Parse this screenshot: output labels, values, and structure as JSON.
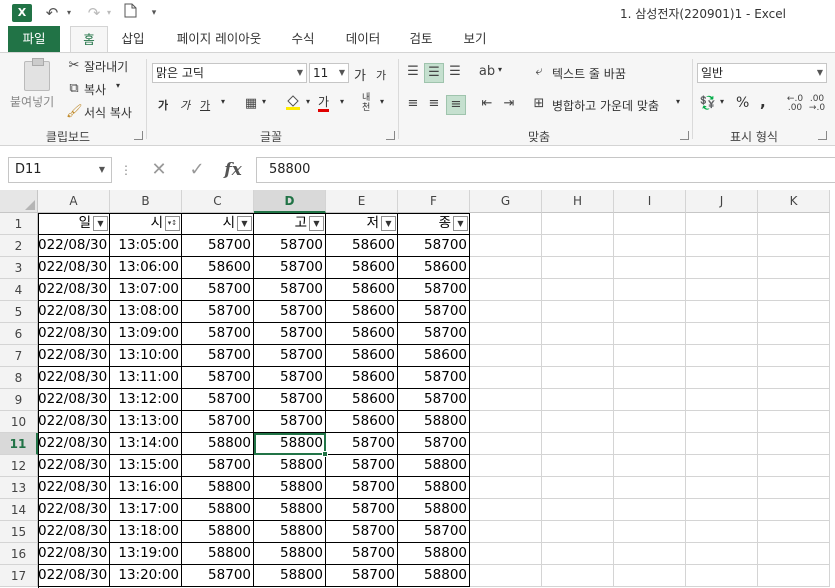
{
  "window": {
    "title": "1. 삼성전자(220901)1 - Excel"
  },
  "quick_access": {
    "save_icon": "save-icon",
    "undo_icon": "undo-icon",
    "redo_icon": "redo-icon",
    "new_icon": "new-file-icon",
    "customize_icon": "customize-icon"
  },
  "tabs": [
    {
      "label": "파일"
    },
    {
      "label": "홈"
    },
    {
      "label": "삽입"
    },
    {
      "label": "페이지 레이아웃"
    },
    {
      "label": "수식"
    },
    {
      "label": "데이터"
    },
    {
      "label": "검토"
    },
    {
      "label": "보기"
    }
  ],
  "ribbon": {
    "clipboard": {
      "paste_label": "붙여넣기",
      "cut_label": "잘라내기",
      "copy_label": "복사",
      "format_painter_label": "서식 복사",
      "group_label": "클립보드"
    },
    "font": {
      "font_name": "맑은 고딕",
      "font_size": "11",
      "grow_label": "가",
      "shrink_label": "가",
      "bold_label": "가",
      "italic_label": "가",
      "underline_label": "가",
      "color_label": "가",
      "phonetic_label": "내천",
      "group_label": "글꼴"
    },
    "alignment": {
      "wrap_label": "텍스트 줄 바꿈",
      "merge_label": "병합하고 가운데 맞춤",
      "group_label": "맞춤"
    },
    "number": {
      "format": "일반",
      "percent_label": "%",
      "comma_label": ",",
      "group_label": "표시 형식"
    }
  },
  "formula_bar": {
    "name_box": "D11",
    "fx_label": "fx",
    "content": "58800"
  },
  "sheet": {
    "columns": [
      "A",
      "B",
      "C",
      "D",
      "E",
      "F",
      "G",
      "H",
      "I",
      "J",
      "K"
    ],
    "selected_column": "D",
    "selected_row": 11,
    "headers": [
      "일",
      "시",
      "시",
      "고",
      "저",
      "종"
    ],
    "rows": [
      [
        "022/08/30",
        "13:05:00",
        "58700",
        "58700",
        "58600",
        "58700"
      ],
      [
        "022/08/30",
        "13:06:00",
        "58600",
        "58700",
        "58600",
        "58600"
      ],
      [
        "022/08/30",
        "13:07:00",
        "58700",
        "58700",
        "58600",
        "58700"
      ],
      [
        "022/08/30",
        "13:08:00",
        "58700",
        "58700",
        "58600",
        "58700"
      ],
      [
        "022/08/30",
        "13:09:00",
        "58700",
        "58700",
        "58600",
        "58700"
      ],
      [
        "022/08/30",
        "13:10:00",
        "58700",
        "58700",
        "58600",
        "58600"
      ],
      [
        "022/08/30",
        "13:11:00",
        "58700",
        "58700",
        "58600",
        "58700"
      ],
      [
        "022/08/30",
        "13:12:00",
        "58700",
        "58700",
        "58600",
        "58700"
      ],
      [
        "022/08/30",
        "13:13:00",
        "58700",
        "58700",
        "58600",
        "58800"
      ],
      [
        "022/08/30",
        "13:14:00",
        "58800",
        "58800",
        "58700",
        "58700"
      ],
      [
        "022/08/30",
        "13:15:00",
        "58700",
        "58800",
        "58700",
        "58800"
      ],
      [
        "022/08/30",
        "13:16:00",
        "58800",
        "58800",
        "58700",
        "58800"
      ],
      [
        "022/08/30",
        "13:17:00",
        "58800",
        "58800",
        "58700",
        "58800"
      ],
      [
        "022/08/30",
        "13:18:00",
        "58800",
        "58800",
        "58700",
        "58700"
      ],
      [
        "022/08/30",
        "13:19:00",
        "58800",
        "58800",
        "58700",
        "58800"
      ],
      [
        "022/08/30",
        "13:20:00",
        "58700",
        "58800",
        "58700",
        "58800"
      ]
    ],
    "accent_color": "#217346"
  }
}
